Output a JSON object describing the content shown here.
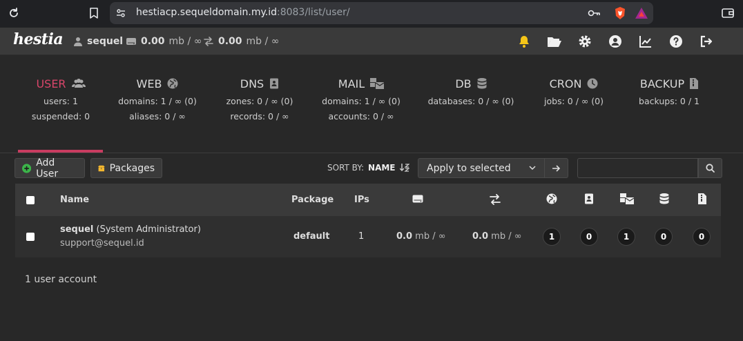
{
  "browser": {
    "url_host": "hestiacp.sequeldomain.my.id",
    "url_rest": ":8083/list/user/"
  },
  "header": {
    "logo": "hestia",
    "username": "sequel",
    "disk_value": "0.00",
    "disk_unit": "mb / ∞",
    "bandwidth_value": "0.00",
    "bandwidth_unit": "mb / ∞"
  },
  "tabs": [
    {
      "title": "USER",
      "icon": "users-icon",
      "stats": [
        "users: 1",
        "suspended: 0"
      ],
      "active": true
    },
    {
      "title": "WEB",
      "icon": "globe-icon",
      "stats": [
        "domains: 1 / ∞ (0)",
        "aliases: 0 / ∞"
      ]
    },
    {
      "title": "DNS",
      "icon": "address-book-icon",
      "stats": [
        "zones: 0 / ∞ (0)",
        "records: 0 / ∞"
      ]
    },
    {
      "title": "MAIL",
      "icon": "mail-bulk-icon",
      "stats": [
        "domains: 1 / ∞ (0)",
        "accounts: 0 / ∞"
      ]
    },
    {
      "title": "DB",
      "icon": "database-icon",
      "stats": [
        "databases: 0 / ∞ (0)"
      ]
    },
    {
      "title": "CRON",
      "icon": "clock-icon",
      "stats": [
        "jobs: 0 / ∞ (0)"
      ]
    },
    {
      "title": "BACKUP",
      "icon": "file-archive-icon",
      "stats": [
        "backups: 0 / 1"
      ]
    }
  ],
  "toolbar": {
    "add_user": "Add User",
    "packages": "Packages",
    "sort_by_label": "SORT BY:",
    "sort_by_value": "NAME",
    "bulk_action": "Apply to selected",
    "search_placeholder": ""
  },
  "table": {
    "headers": {
      "name": "Name",
      "package": "Package",
      "ips": "IPs"
    },
    "rows": [
      {
        "username": "sequel",
        "role": "(System Administrator)",
        "email": "support@sequel.id",
        "package": "default",
        "ips": "1",
        "disk_value": "0.0",
        "disk_unit": "mb / ∞",
        "bandwidth_value": "0.0",
        "bandwidth_unit": "mb / ∞",
        "web": "1",
        "dns": "0",
        "mail": "1",
        "db": "0",
        "backups": "0"
      }
    ]
  },
  "footer": {
    "count": "1 user account"
  },
  "colors": {
    "accent": "#d9466a",
    "bell": "#f5c518",
    "folder": "#f5c518",
    "add": "#3cb54a"
  }
}
